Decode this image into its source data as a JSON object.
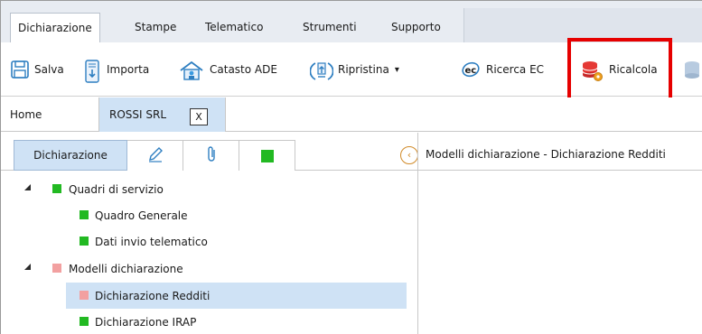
{
  "menu": {
    "items": [
      "Dichiarazione",
      "Stampe",
      "Telematico",
      "Strumenti",
      "Supporto"
    ],
    "active_index": 0
  },
  "toolbar": {
    "salva": "Salva",
    "importa": "Importa",
    "catasto": "Catasto ADE",
    "ripristina": "Ripristina",
    "ripristina_arrow": "▾",
    "ricerca": "Ricerca EC",
    "ricalcola": "Ricalcola"
  },
  "tabs": {
    "home": "Home",
    "doc": "ROSSI SRL",
    "close": "X"
  },
  "left_panel": {
    "main_tab": "Dichiarazione",
    "collapse_glyph": "‹"
  },
  "right_panel": {
    "title": "Modelli dichiarazione - Dichiarazione Redditi"
  },
  "tree": {
    "rows": [
      {
        "label": "Quadri di servizio",
        "level": 0,
        "expanded": true,
        "status_color": "#22b922"
      },
      {
        "label": "Quadro Generale",
        "level": 1,
        "status_color": "#22b922"
      },
      {
        "label": "Dati invio telematico",
        "level": 1,
        "status_color": "#22b922"
      },
      {
        "label": "Modelli dichiarazione",
        "level": 0,
        "expanded": true,
        "status_color": "#f2a0a0"
      },
      {
        "label": "Dichiarazione Redditi",
        "level": 1,
        "status_color": "#f2a0a0",
        "selected": true
      },
      {
        "label": "Dichiarazione IRAP",
        "level": 1,
        "status_color": "#22b922"
      }
    ]
  },
  "colors": {
    "ok_green": "#22b922",
    "error_pink": "#f2a0a0",
    "highlight_red": "#e60000",
    "selection_blue": "#cfe2f5"
  }
}
